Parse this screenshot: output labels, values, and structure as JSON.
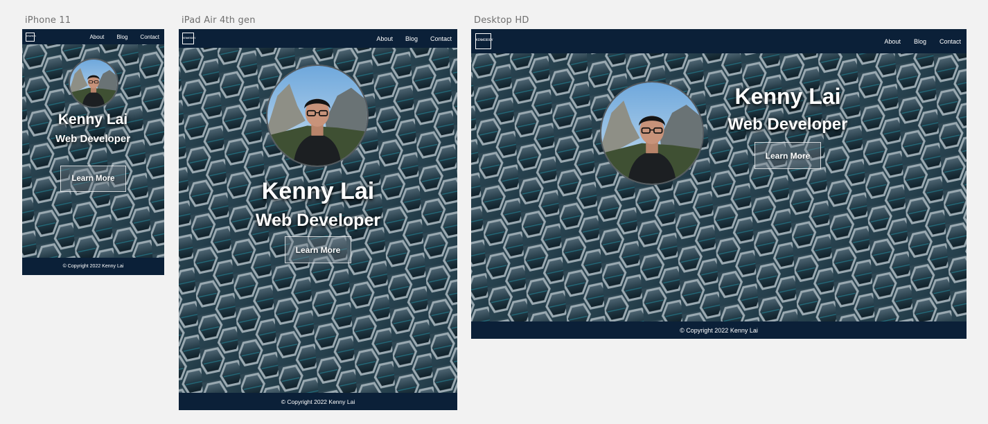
{
  "frames": [
    {
      "label": "iPhone 11",
      "nav": {
        "logo": [
          "KEN",
          "WEB",
          "DEV"
        ],
        "links": [
          "About",
          "Blog",
          "Contact"
        ]
      },
      "hero": {
        "name": "Kenny Lai",
        "title": "Web Developer",
        "cta": "Learn More"
      },
      "footer": "© Copyright 2022 Kenny Lai"
    },
    {
      "label": "iPad Air 4th gen",
      "nav": {
        "logo": [
          "KEN",
          "WEB",
          "DEV"
        ],
        "links": [
          "About",
          "Blog",
          "Contact"
        ]
      },
      "hero": {
        "name": "Kenny Lai",
        "title": "Web Developer",
        "cta": "Learn More"
      },
      "footer": "© Copyright 2022 Kenny Lai"
    },
    {
      "label": "Desktop HD",
      "nav": {
        "logo": [
          "KEN",
          "WEB",
          "DEV"
        ],
        "links": [
          "About",
          "Blog",
          "Contact"
        ]
      },
      "hero": {
        "name": "Kenny Lai",
        "title": "Web Developer",
        "cta": "Learn More"
      },
      "footer": "© Copyright 2022 Kenny Lai"
    }
  ],
  "colors": {
    "canvas": "#f2f2f2",
    "navy": "#0b2038",
    "label": "#6f6f6f",
    "text": "#ffffff"
  },
  "icons": {
    "logo": "ken-web-dev-logo-icon",
    "avatar": "profile-photo"
  }
}
